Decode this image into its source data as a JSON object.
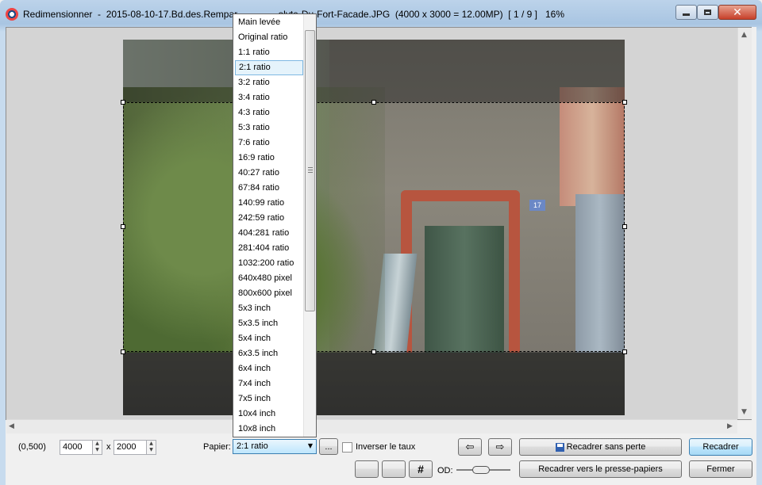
{
  "window": {
    "title": "Redimensionner  -  2015-08-10-17.Bd.des.Rempar",
    "title_tail": "olyte-Du-Fort-Facade.JPG  (4000 x 3000 = 12.00MP)  [ 1 / 9 ]   16%",
    "min_label": "minimize",
    "max_label": "maximize",
    "close_glyph": "✕"
  },
  "photo": {
    "plate_number": "17"
  },
  "ratio_list": {
    "selected_index": 3,
    "items": [
      "Main levée",
      "Original ratio",
      "1:1 ratio",
      "2:1 ratio",
      "3:2 ratio",
      "3:4 ratio",
      "4:3 ratio",
      "5:3 ratio",
      "7:6 ratio",
      "16:9 ratio",
      "40:27 ratio",
      "67:84 ratio",
      "140:99 ratio",
      "242:59 ratio",
      "404:281 ratio",
      "281:404 ratio",
      "1032:200 ratio",
      "640x480 pixel",
      "800x600 pixel",
      "5x3 inch",
      "5x3.5 inch",
      "5x4 inch",
      "6x3.5 inch",
      "6x4 inch",
      "7x4 inch",
      "7x5 inch",
      "10x4 inch",
      "10x8 inch"
    ]
  },
  "controls": {
    "position_readout": "(0,500)",
    "width_value": "4000",
    "times_sign": "x",
    "height_value": "2000",
    "paper_label": "Papier:",
    "paper_value": "2:1 ratio",
    "ellipsis_label": "...",
    "invert_label": "Inverser le taux",
    "prev_arrow": "⇦",
    "next_arrow": "⇨",
    "lossless_crop_label": "Recadrer sans perte",
    "crop_label": "Recadrer",
    "grid_glyph": "#",
    "od_label": "OD:",
    "clipboard_crop_label": "Recadrer vers le presse-papiers",
    "close_label": "Fermer"
  }
}
